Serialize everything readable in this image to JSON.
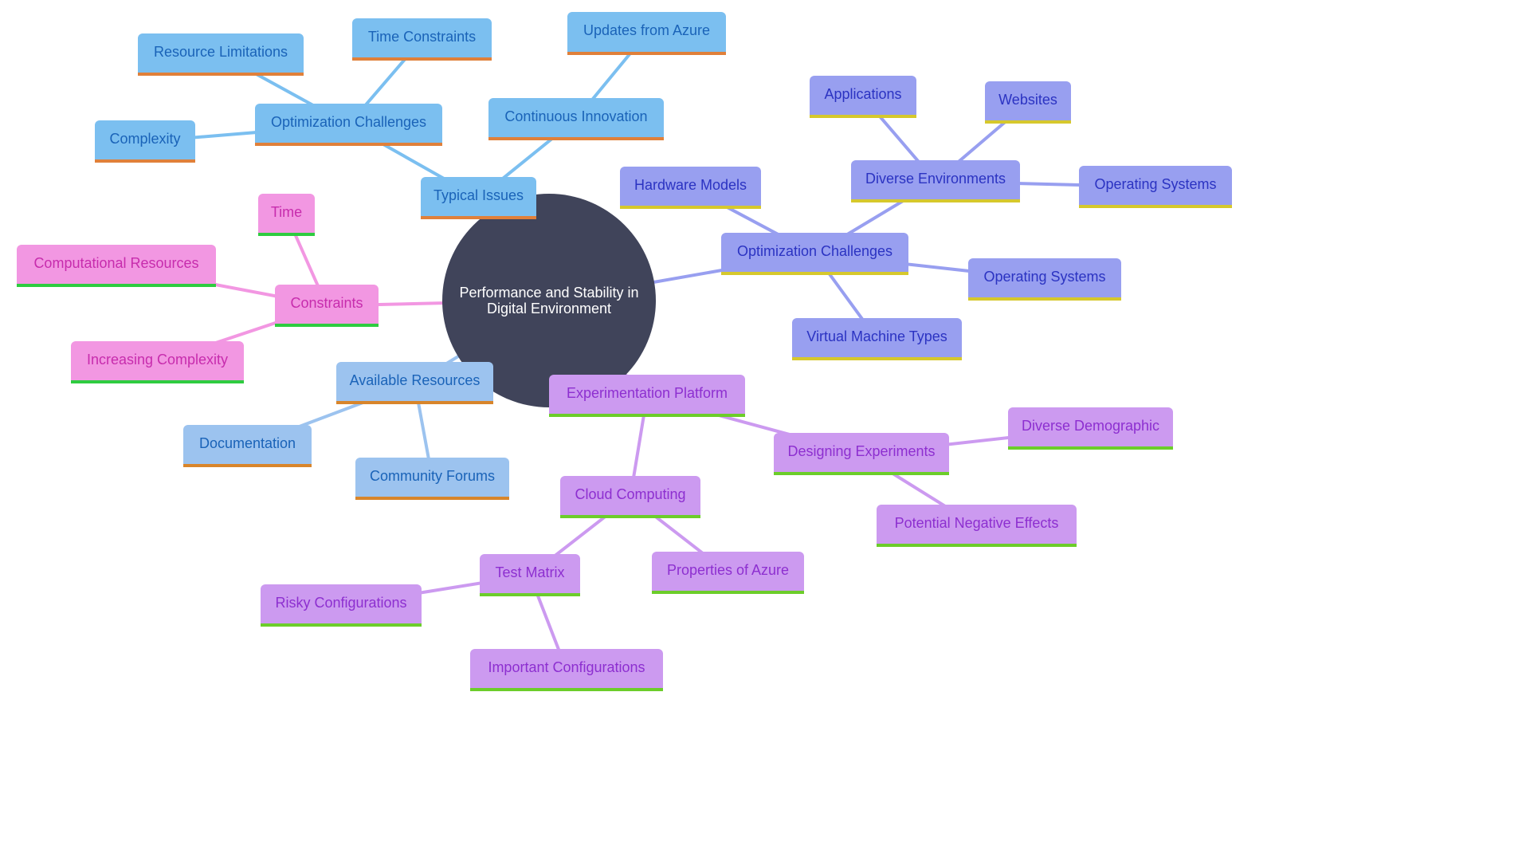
{
  "diagram": {
    "type": "mindmap",
    "root": {
      "id": "root",
      "label": "Performance and Stability in Digital Environment",
      "label_lines": [
        "Performance and Stability in",
        "Digital Environment"
      ],
      "fill": "#40445a",
      "text_color": "#ffffff"
    },
    "styles": {
      "blue": {
        "fill": "#7bbff0",
        "text": "#1a63b8",
        "border": "#e0803a",
        "edge": "#7bbff0"
      },
      "lightblue": {
        "fill": "#9cc3ef",
        "text": "#1a63b8",
        "border": "#d8852b",
        "edge": "#9cc3ef"
      },
      "periwinkle": {
        "fill": "#989ff0",
        "text": "#2b33c2",
        "border": "#d6c82c",
        "edge": "#989ff0"
      },
      "pink": {
        "fill": "#f297e2",
        "text": "#c72cad",
        "border": "#2ecc40",
        "edge": "#f297e2"
      },
      "purple": {
        "fill": "#cc9af0",
        "text": "#8d2fd0",
        "border": "#6ccd2a",
        "edge": "#cc9af0"
      }
    },
    "nodes": [
      {
        "id": "typical-issues",
        "label": "Typical Issues",
        "parent": "root",
        "style": "blue"
      },
      {
        "id": "optimization-challenges-1",
        "label": "Optimization Challenges",
        "parent": "typical-issues",
        "style": "blue"
      },
      {
        "id": "resource-limitations",
        "label": "Resource Limitations",
        "parent": "optimization-challenges-1",
        "style": "blue"
      },
      {
        "id": "time-constraints",
        "label": "Time Constraints",
        "parent": "optimization-challenges-1",
        "style": "blue"
      },
      {
        "id": "complexity",
        "label": "Complexity",
        "parent": "optimization-challenges-1",
        "style": "blue"
      },
      {
        "id": "continuous-innovation",
        "label": "Continuous Innovation",
        "parent": "typical-issues",
        "style": "blue"
      },
      {
        "id": "updates-from-azure",
        "label": "Updates from Azure",
        "parent": "continuous-innovation",
        "style": "blue"
      },
      {
        "id": "optimization-challenges-2",
        "label": "Optimization Challenges",
        "parent": "root",
        "style": "periwinkle"
      },
      {
        "id": "hardware-models",
        "label": "Hardware Models",
        "parent": "optimization-challenges-2",
        "style": "periwinkle"
      },
      {
        "id": "diverse-environments",
        "label": "Diverse Environments",
        "parent": "optimization-challenges-2",
        "style": "periwinkle"
      },
      {
        "id": "applications",
        "label": "Applications",
        "parent": "diverse-environments",
        "style": "periwinkle"
      },
      {
        "id": "websites",
        "label": "Websites",
        "parent": "diverse-environments",
        "style": "periwinkle"
      },
      {
        "id": "operating-systems-1",
        "label": "Operating Systems",
        "parent": "diverse-environments",
        "style": "periwinkle"
      },
      {
        "id": "operating-systems-2",
        "label": "Operating Systems",
        "parent": "optimization-challenges-2",
        "style": "periwinkle"
      },
      {
        "id": "virtual-machine-types",
        "label": "Virtual Machine Types",
        "parent": "optimization-challenges-2",
        "style": "periwinkle"
      },
      {
        "id": "constraints",
        "label": "Constraints",
        "parent": "root",
        "style": "pink"
      },
      {
        "id": "time",
        "label": "Time",
        "parent": "constraints",
        "style": "pink"
      },
      {
        "id": "computational-resources",
        "label": "Computational Resources",
        "parent": "constraints",
        "style": "pink"
      },
      {
        "id": "increasing-complexity",
        "label": "Increasing Complexity",
        "parent": "constraints",
        "style": "pink"
      },
      {
        "id": "available-resources",
        "label": "Available Resources",
        "parent": "root",
        "style": "lightblue"
      },
      {
        "id": "documentation",
        "label": "Documentation",
        "parent": "available-resources",
        "style": "lightblue"
      },
      {
        "id": "community-forums",
        "label": "Community Forums",
        "parent": "available-resources",
        "style": "lightblue"
      },
      {
        "id": "experimentation-platform",
        "label": "Experimentation Platform",
        "parent": "root",
        "style": "purple"
      },
      {
        "id": "designing-experiments",
        "label": "Designing Experiments",
        "parent": "experimentation-platform",
        "style": "purple"
      },
      {
        "id": "diverse-demographic",
        "label": "Diverse Demographic",
        "parent": "designing-experiments",
        "style": "purple"
      },
      {
        "id": "potential-negative-effects",
        "label": "Potential Negative Effects",
        "parent": "designing-experiments",
        "style": "purple"
      },
      {
        "id": "cloud-computing",
        "label": "Cloud Computing",
        "parent": "experimentation-platform",
        "style": "purple"
      },
      {
        "id": "properties-of-azure",
        "label": "Properties of Azure",
        "parent": "cloud-computing",
        "style": "purple"
      },
      {
        "id": "test-matrix",
        "label": "Test Matrix",
        "parent": "cloud-computing",
        "style": "purple"
      },
      {
        "id": "risky-configurations",
        "label": "Risky Configurations",
        "parent": "test-matrix",
        "style": "purple"
      },
      {
        "id": "important-configurations",
        "label": "Important Configurations",
        "parent": "test-matrix",
        "style": "purple"
      }
    ]
  }
}
